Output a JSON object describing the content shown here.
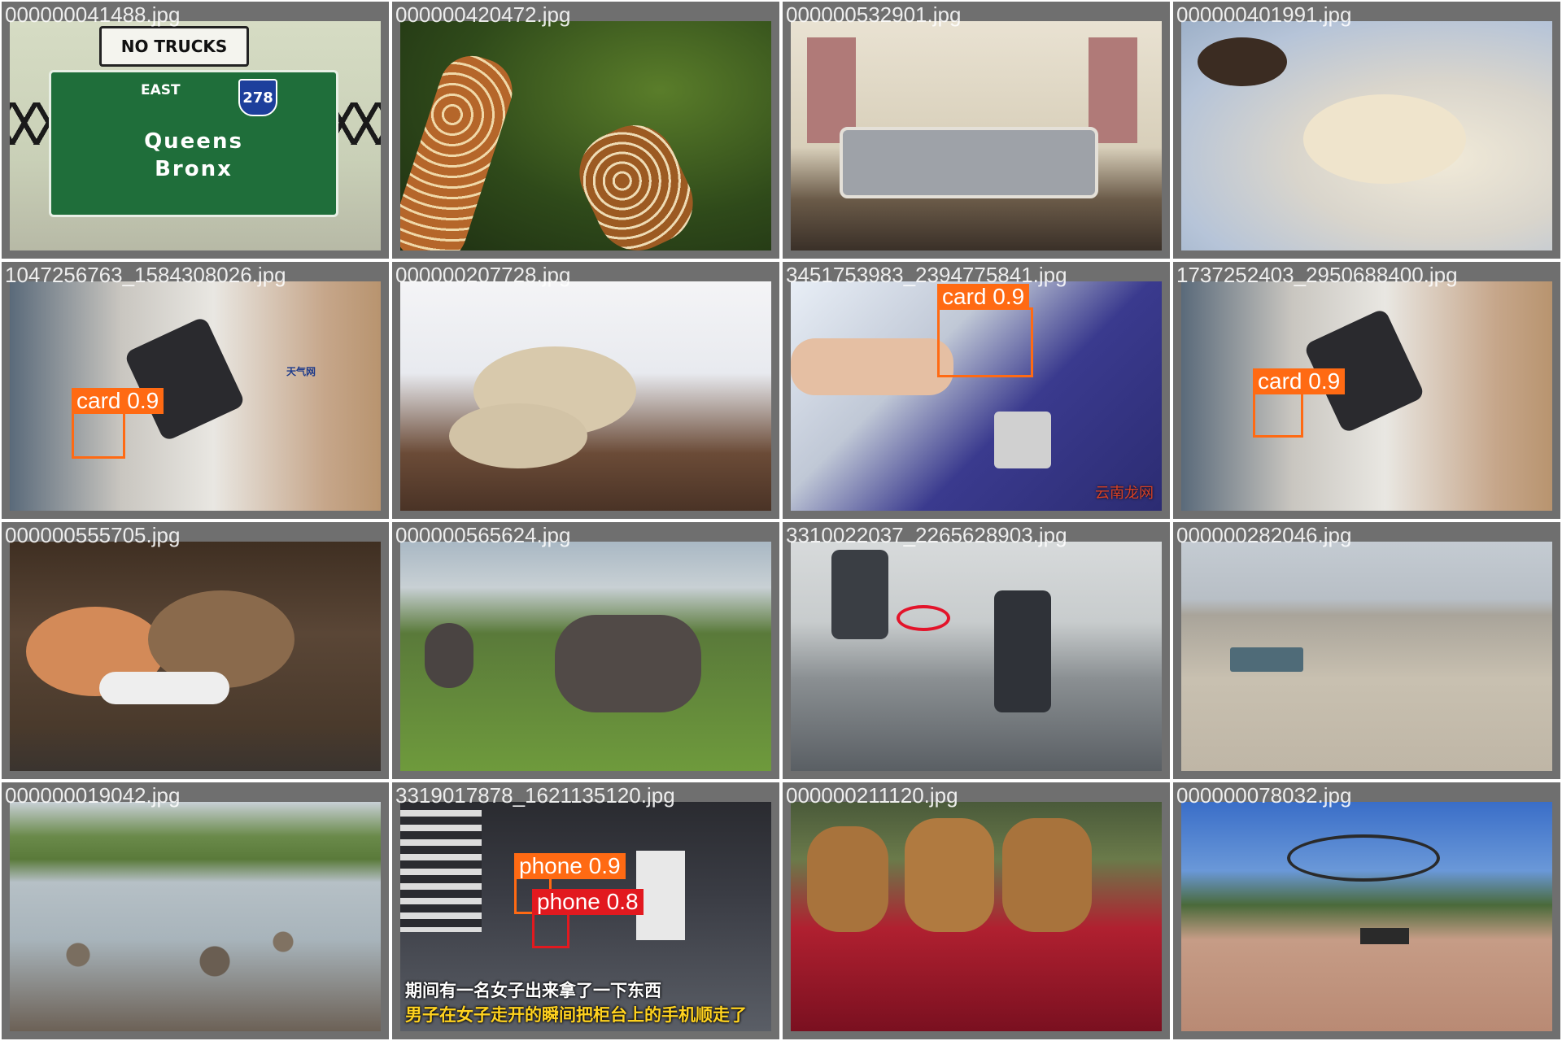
{
  "tiles": [
    {
      "filename": "000000041488.jpg",
      "sign": {
        "top": "NO TRUCKS",
        "direction": "EAST",
        "route": "278",
        "line1": "Queens",
        "line2": "Bronx"
      }
    },
    {
      "filename": "000000420472.jpg"
    },
    {
      "filename": "000000532901.jpg"
    },
    {
      "filename": "000000401991.jpg"
    },
    {
      "filename": "1047256763_1584308026.jpg",
      "detections": [
        {
          "label": "card 0.9"
        }
      ],
      "watermark": "天气网"
    },
    {
      "filename": "000000207728.jpg"
    },
    {
      "filename": "3451753983_2394775841.jpg",
      "detections": [
        {
          "label": "card 0.9"
        }
      ],
      "watermark": "云南龙网"
    },
    {
      "filename": "1737252403_2950688400.jpg",
      "detections": [
        {
          "label": "card 0.9"
        }
      ]
    },
    {
      "filename": "000000555705.jpg"
    },
    {
      "filename": "000000565624.jpg"
    },
    {
      "filename": "3310022037_2265628903.jpg"
    },
    {
      "filename": "000000282046.jpg"
    },
    {
      "filename": "000000019042.jpg"
    },
    {
      "filename": "3319017878_1621135120.jpg",
      "detections": [
        {
          "label": "phone 0.9"
        },
        {
          "label": "phone 0.8"
        }
      ],
      "captions": [
        "期间有一名女子出来拿了一下东西",
        "男子在女子走开的瞬间把柜台上的手机顺走了"
      ]
    },
    {
      "filename": "000000211120.jpg"
    },
    {
      "filename": "000000078032.jpg"
    }
  ],
  "colors": {
    "detection_box": "#ff6a13",
    "background": "#6f6f6f"
  }
}
